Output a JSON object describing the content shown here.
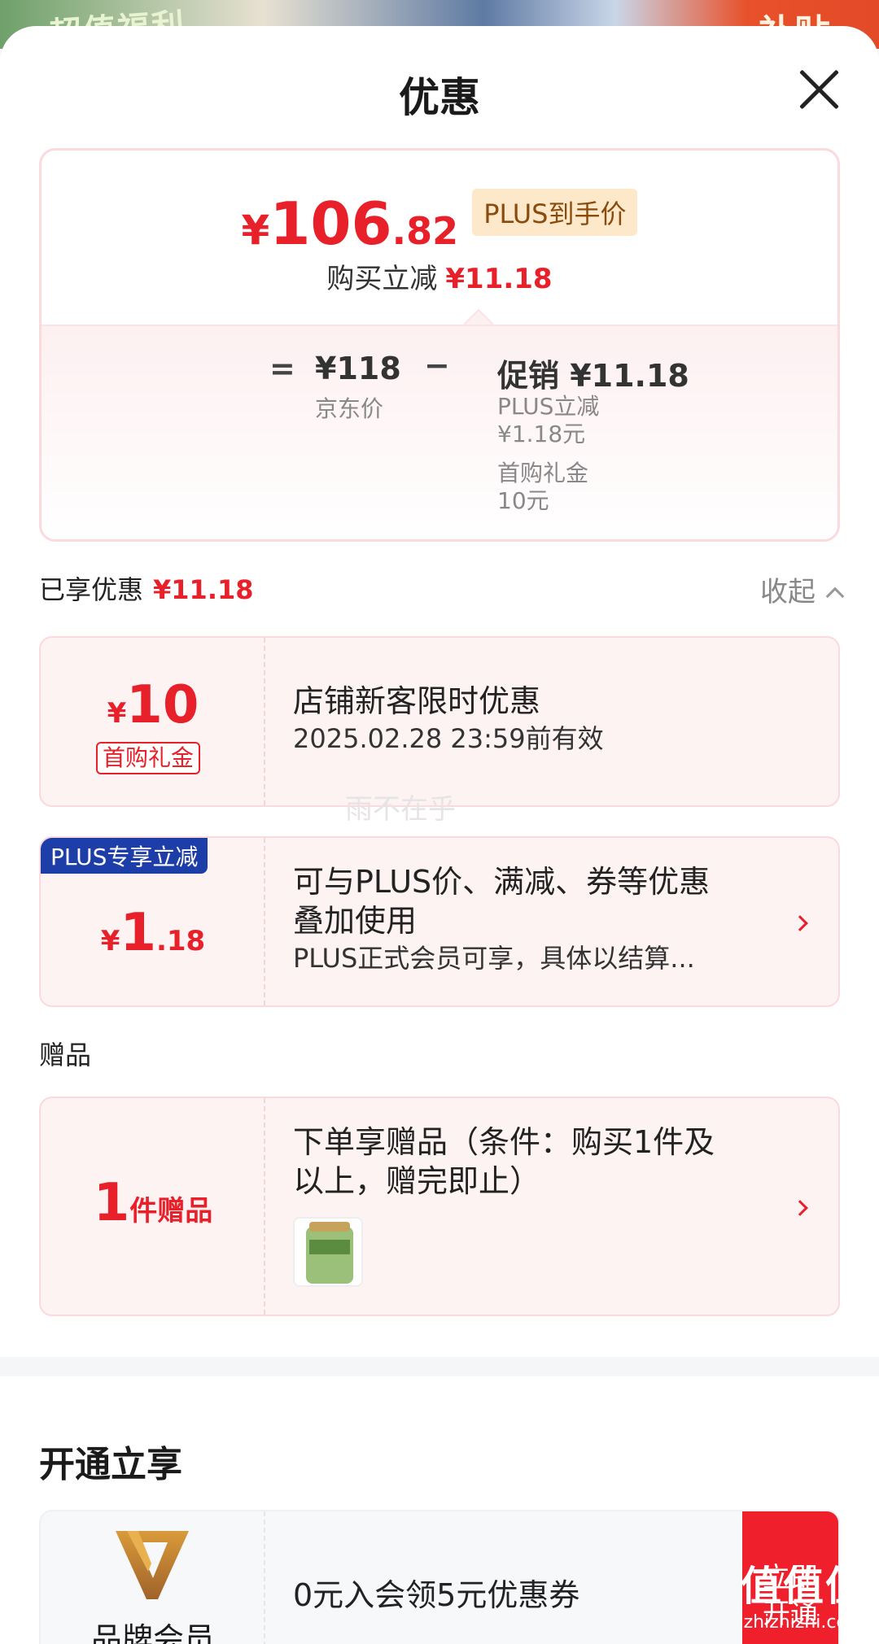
{
  "backdrop": {
    "left_text": "超值福利",
    "right_text": "补贴"
  },
  "header": {
    "title": "优惠"
  },
  "price": {
    "yen": "¥",
    "integer": "106",
    "decimal": ".82",
    "badge": "PLUS到手价",
    "save_label": "购买立减",
    "save_amount": "¥11.18"
  },
  "formula": {
    "equals": "=",
    "base_price": "¥118",
    "base_label": "京东价",
    "minus": "−",
    "promo": "促销 ¥11.18",
    "details": [
      "PLUS立减",
      "¥1.18元",
      "首购礼金",
      "10元"
    ]
  },
  "enjoyed": {
    "label": "已享优惠",
    "amount": "¥11.18",
    "collapse_label": "收起"
  },
  "coupons": [
    {
      "yen": "¥",
      "amount": "10",
      "decimal": "",
      "tag": "首购礼金",
      "title": "店铺新客限时优惠",
      "subtitle": "2025.02.28 23:59前有效"
    },
    {
      "yen": "¥",
      "amount": "1",
      "decimal": ".18",
      "tag": "PLUS专享立减",
      "title_line1": "可与PLUS价、满减、券等优惠",
      "title_line2": "叠加使用",
      "subtitle": "PLUS正式会员可享，具体以结算..."
    }
  ],
  "watermark": "雨不在乎",
  "gift_section": {
    "label": "赠品",
    "count": "1",
    "unit": "件赠品",
    "title_line1": "下单享赠品（条件：购买1件及",
    "title_line2": "以上，赠完即止）"
  },
  "open_section": {
    "title": "开通立享",
    "member_name": "品牌会员",
    "member_text": "0元入会领5元优惠券",
    "button_line1": "立即",
    "button_line2": "开通"
  },
  "site_mark": {
    "logo": "值值值",
    "url": "zhizhizhi.com"
  },
  "colors": {
    "accent": "#e8202a",
    "plus_blue": "#1d3ea8",
    "badge_bg": "#fde9c9",
    "open_btn": "#ef1f2c"
  }
}
